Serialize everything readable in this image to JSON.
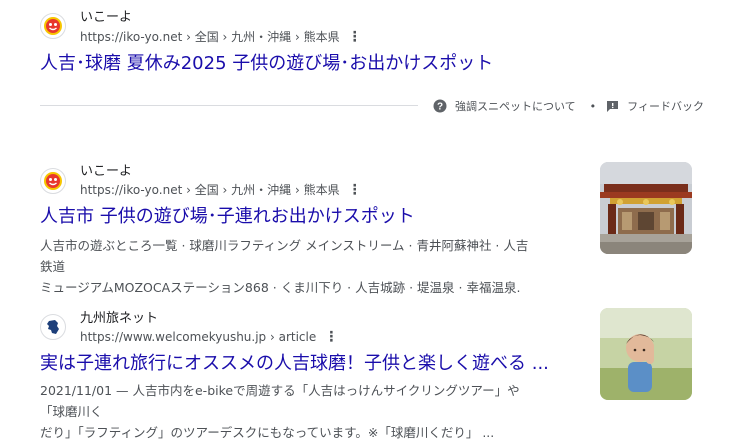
{
  "results": [
    {
      "site_name": "いこーよ",
      "url": "https://iko-yo.net › 全国 › 九州・沖縄 › 熊本県",
      "title": "人吉･球磨 夏休み2025 子供の遊び場･お出かけスポット",
      "favicon_icon": "ikoyo-face-icon"
    },
    {
      "site_name": "いこーよ",
      "url": "https://iko-yo.net › 全国 › 九州・沖縄 › 熊本県",
      "title": "人吉市 子供の遊び場･子連れお出かけスポット",
      "snippet_line1": "人吉市の遊ぶところ一覧 · 球磨川ラフティング メインストリーム · 青井阿蘇神社 · 人吉鉄道",
      "snippet_line2": "ミュージアムMOZOCAステーション868 · くま川下り · 人吉城跡 · 堤温泉 · 幸福温泉.",
      "favicon_icon": "ikoyo-face-icon",
      "thumbnail": "shrine-gate-photo"
    },
    {
      "site_name": "九州旅ネット",
      "url": "https://www.welcomekyushu.jp › article",
      "title": "実は子連れ旅行にオススメの人吉球磨！子供と楽しく遊べる ...",
      "snippet_line1": "2021/11/01 — 人吉市内をe-bikeで周遊する「人吉はっけんサイクリングツアー」や「球磨川く",
      "snippet_line2": "だり」「ラフティング」のツアーデスクにもなっています。※「球磨川くだり」 ...",
      "favicon_icon": "kyushu-map-icon",
      "thumbnail": "child-photo"
    }
  ],
  "feedback": {
    "about_snippets": "強調スニペットについて",
    "separator": "•",
    "feedback_label": "フィードバック"
  },
  "kebab": "⋮",
  "colors": {
    "link": "#1a0dab",
    "text": "#4d5156",
    "divider": "#dadce0"
  }
}
